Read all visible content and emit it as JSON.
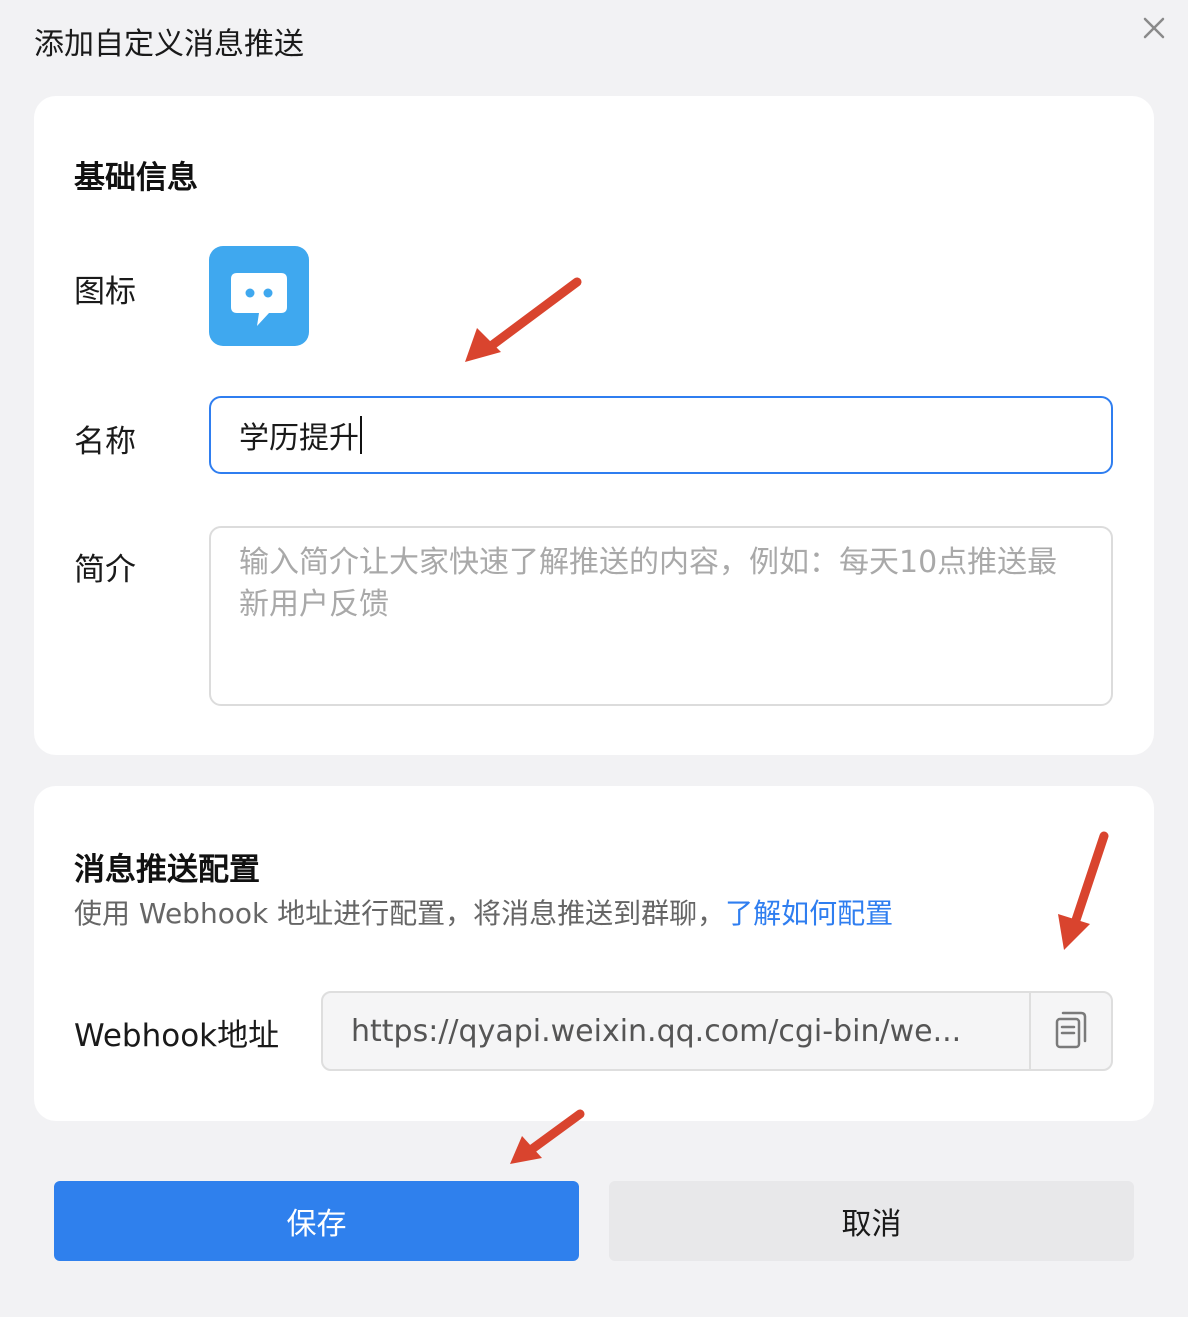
{
  "dialog": {
    "title": "添加自定义消息推送"
  },
  "basic_info": {
    "section_title": "基础信息",
    "icon_label": "图标",
    "name_label": "名称",
    "name_value": "学历提升",
    "intro_label": "简介",
    "intro_placeholder": "输入简介让大家快速了解推送的内容，例如：每天10点推送最新用户反馈"
  },
  "push_config": {
    "section_title": "消息推送配置",
    "description": "使用 Webhook 地址进行配置，将消息推送到群聊，",
    "help_link": "了解如何配置",
    "webhook_label": "Webhook地址",
    "webhook_value": "https://qyapi.weixin.qq.com/cgi-bin/we..."
  },
  "buttons": {
    "save": "保存",
    "cancel": "取消"
  },
  "colors": {
    "accent": "#2f80ed",
    "icon_tile": "#3fa8ef",
    "annotation_arrow": "#d9442e"
  },
  "icons": {
    "close": "close-icon",
    "chat": "chat-bubble-icon",
    "copy": "copy-icon"
  }
}
